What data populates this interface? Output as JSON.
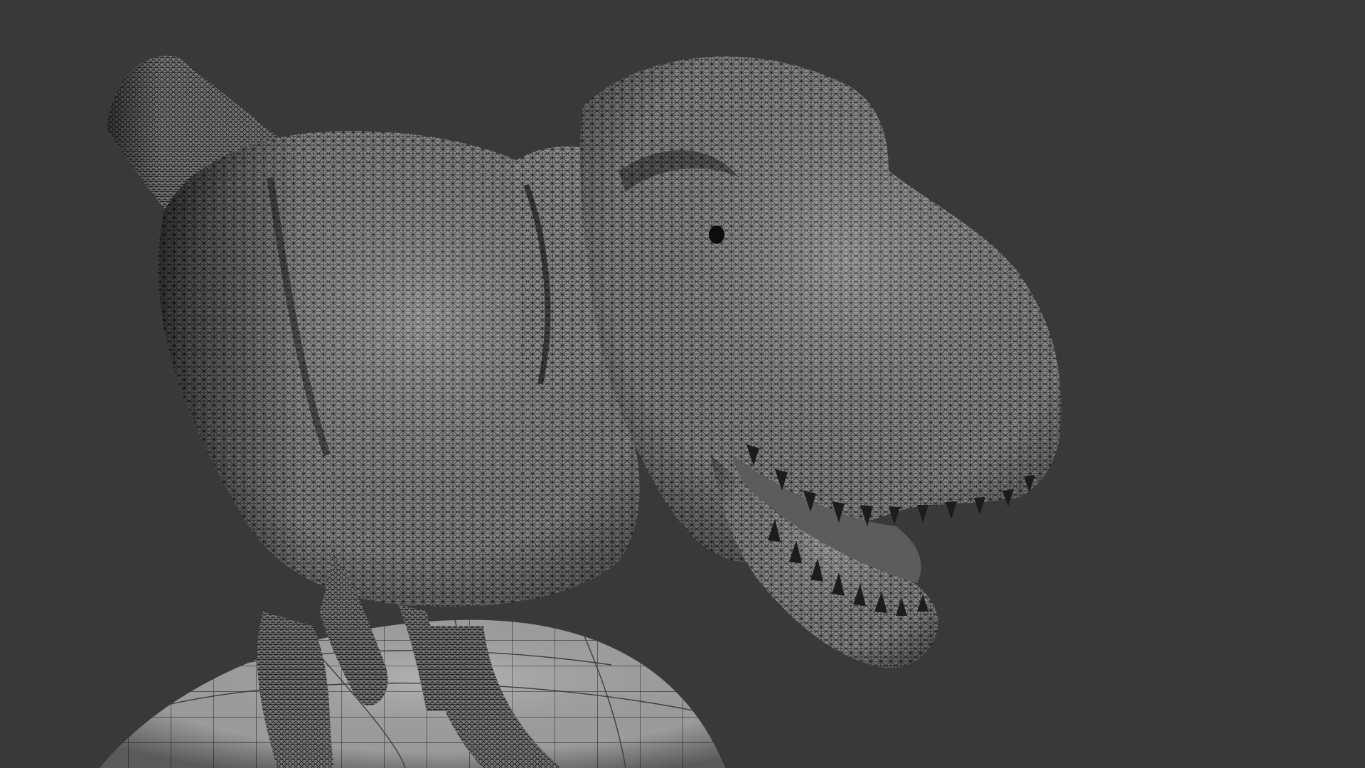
{
  "viewport": {
    "background_color": "#393939",
    "shading_mode": "wireframe-overlay-solid"
  },
  "scene": {
    "model": "tyrannosaurus-rex",
    "base_object": "sphere-pedestal",
    "mesh_face_color": "#8c8c8c",
    "mesh_wire_color": "#1a1a1a",
    "base_face_color": "#9a9a9a",
    "base_wire_color": "#3a3a3a"
  }
}
